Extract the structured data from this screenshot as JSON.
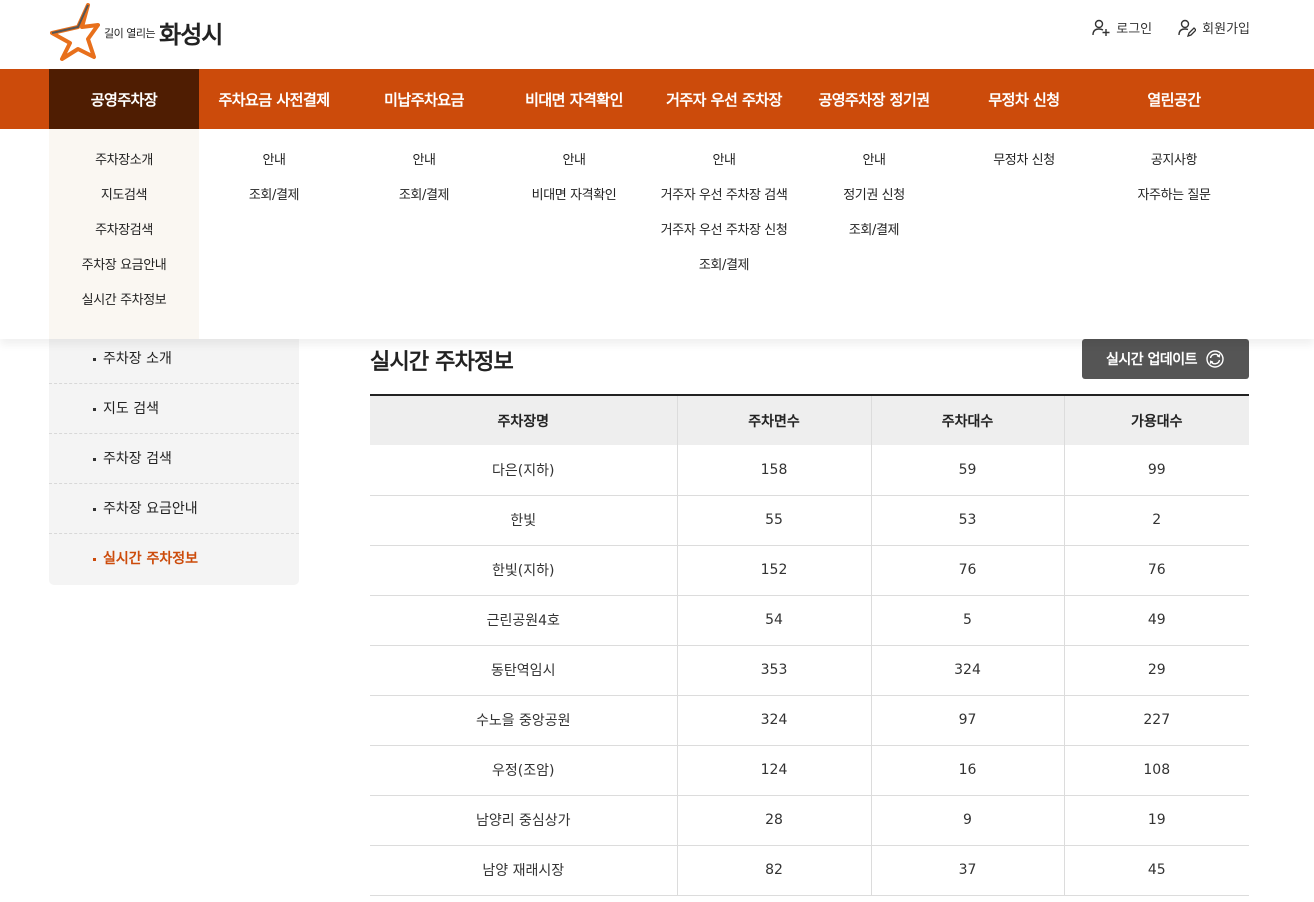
{
  "header": {
    "logo_sub": "길이 열리는",
    "logo_main": "화성시",
    "util": [
      {
        "label": "로그인",
        "icon": "user-plus-icon"
      },
      {
        "label": "회원가입",
        "icon": "user-edit-icon"
      }
    ]
  },
  "gnb": [
    {
      "label": "공영주차장",
      "active": true
    },
    {
      "label": "주차요금 사전결제"
    },
    {
      "label": "미납주차요금"
    },
    {
      "label": "비대면 자격확인"
    },
    {
      "label": "거주자 우선 주차장"
    },
    {
      "label": "공영주차장 정기권"
    },
    {
      "label": "무정차 신청"
    },
    {
      "label": "열린공간"
    }
  ],
  "mega": [
    [
      "주차장소개",
      "지도검색",
      "주차장검색",
      "주차장 요금안내",
      "실시간 주차정보"
    ],
    [
      "안내",
      "조회/결제"
    ],
    [
      "안내",
      "조회/결제"
    ],
    [
      "안내",
      "비대면 자격확인"
    ],
    [
      "안내",
      "거주자 우선 주차장 검색",
      "거주자 우선 주차장 신청",
      "조회/결제"
    ],
    [
      "안내",
      "정기권 신청",
      "조회/결제"
    ],
    [
      "무정차 신청"
    ],
    [
      "공지사항",
      "자주하는 질문"
    ]
  ],
  "lnb": {
    "items": [
      "주차장 소개",
      "지도 검색",
      "주차장 검색",
      "주차장 요금안내",
      "실시간 주차정보"
    ],
    "active_index": 4
  },
  "content": {
    "title": "실시간 주차정보",
    "refresh_label": "실시간 업데이트",
    "columns": [
      "주차장명",
      "주차면수",
      "주차대수",
      "가용대수"
    ],
    "rows": [
      [
        "다은(지하)",
        "158",
        "59",
        "99"
      ],
      [
        "한빛",
        "55",
        "53",
        "2"
      ],
      [
        "한빛(지하)",
        "152",
        "76",
        "76"
      ],
      [
        "근린공원4호",
        "54",
        "5",
        "49"
      ],
      [
        "동탄역임시",
        "353",
        "324",
        "29"
      ],
      [
        "수노을 중앙공원",
        "324",
        "97",
        "227"
      ],
      [
        "우정(조암)",
        "124",
        "16",
        "108"
      ],
      [
        "남양리 중심상가",
        "28",
        "9",
        "19"
      ],
      [
        "남양 재래시장",
        "82",
        "37",
        "45"
      ]
    ]
  },
  "colors": {
    "brand": "#cc4b0b",
    "brand_dark": "#4f1d02",
    "button": "#555555"
  }
}
